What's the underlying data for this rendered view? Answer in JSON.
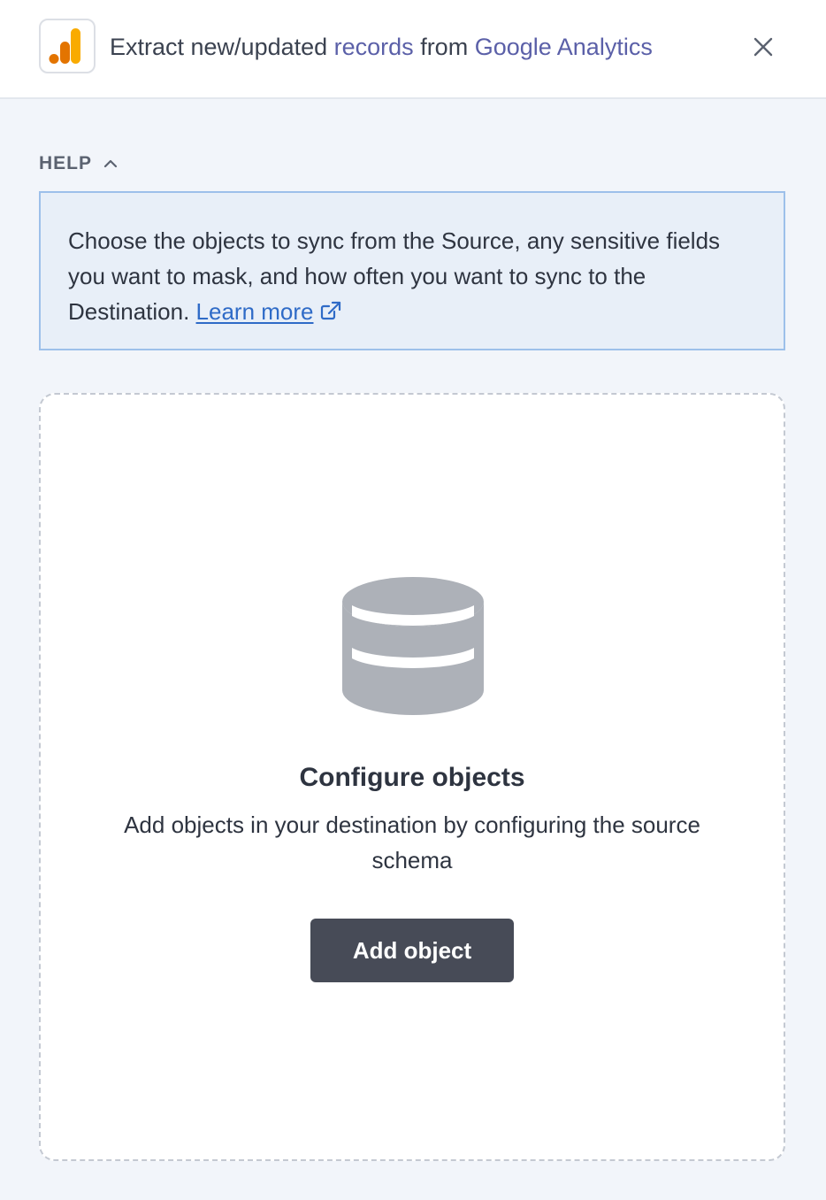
{
  "header": {
    "title_part1": "Extract new/updated ",
    "title_accent1": "records",
    "title_part2": " from ",
    "title_accent2": "Google Analytics",
    "logo_icon": "google-analytics-logo",
    "close_icon": "close-icon"
  },
  "help": {
    "label": "HELP",
    "toggle_icon": "chevron-up-icon",
    "text": "Choose the objects to sync from the Source, any sensitive fields you want to mask, and how often you want to sync to the Destination. ",
    "link_label": "Learn more",
    "link_icon": "external-link-icon"
  },
  "empty_state": {
    "icon": "database-icon",
    "title": "Configure objects",
    "description": "Add objects in your destination by configuring the source schema",
    "button_label": "Add object"
  },
  "colors": {
    "accent_text": "#5b60a8",
    "link": "#2f6bc7",
    "help_bg": "#e8eff8",
    "help_border": "#9dc0ea",
    "button_bg": "#474b57",
    "logo_orange": "#f9ab00",
    "logo_dark_orange": "#e37400"
  }
}
